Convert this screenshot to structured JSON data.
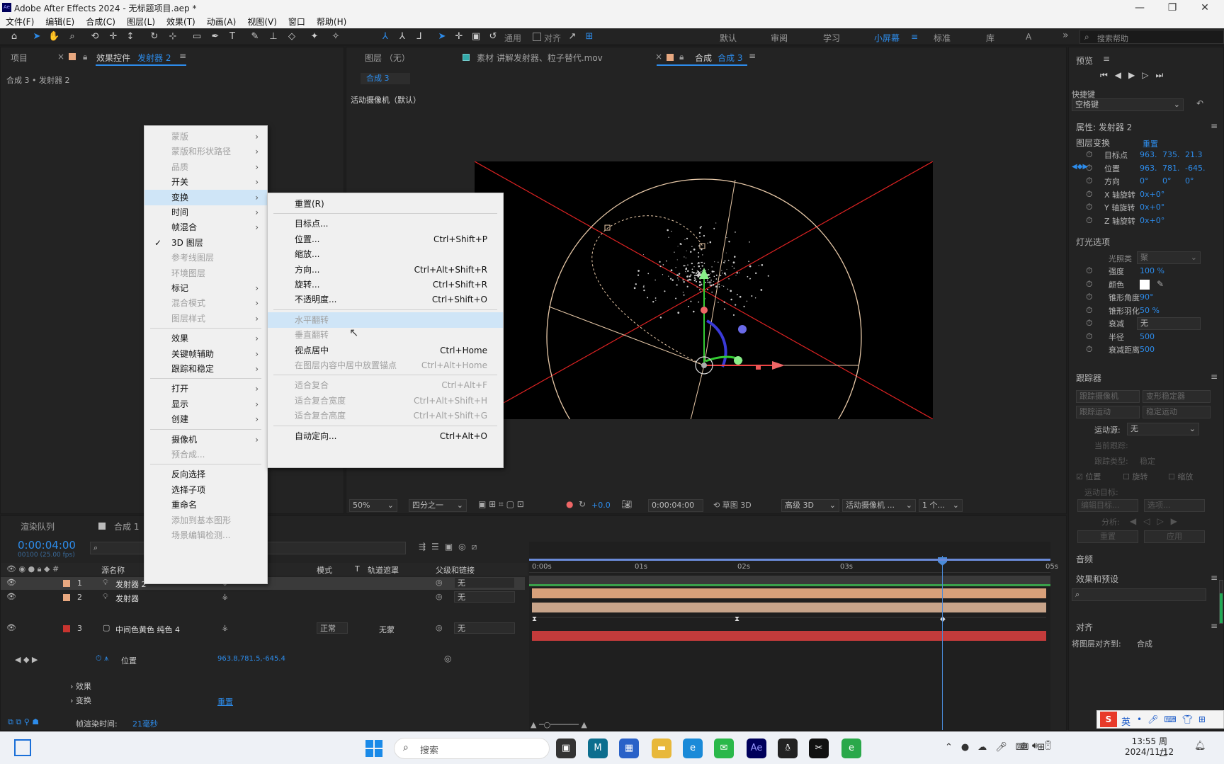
{
  "app": {
    "title": "Adobe After Effects 2024 - 无标题项目.aep *",
    "icon": "Ae"
  },
  "menu": [
    "文件(F)",
    "编辑(E)",
    "合成(C)",
    "图层(L)",
    "效果(T)",
    "动画(A)",
    "视图(V)",
    "窗口",
    "帮助(H)"
  ],
  "toolbar": {
    "general": "通用",
    "align": "对齐",
    "workspaces": [
      "默认",
      "审阅",
      "学习",
      "小屏幕",
      "标准",
      "库"
    ],
    "active_workspace": "小屏幕",
    "search_placeholder": "搜索帮助",
    "more": "»"
  },
  "left_panel": {
    "tab_project": "项目",
    "tab_effects": "效果控件",
    "effects_layer": "发射器 2",
    "breadcrumb": "合成 3 • 发射器 2"
  },
  "viewer": {
    "tab_layer": "图层 （无）",
    "tab_footage": "素材 讲解发射器、粒子替代.mov",
    "tab_comp": "合成",
    "tab_comp_name": "合成 3",
    "comp_chip": "合成 3",
    "camera_label": "活动摄像机（默认）",
    "zoom": "50%",
    "resolution": "四分之一",
    "exposure": "+0.0",
    "timecode": "0:00:04:00",
    "draft3d": "草图 3D",
    "renderer": "高级 3D",
    "view": "活动摄像机 ...",
    "views": "1 个..."
  },
  "ctx_main": [
    {
      "label": "蒙版",
      "dis": true,
      "sub": true
    },
    {
      "label": "蒙版和形状路径",
      "dis": true,
      "sub": true
    },
    {
      "label": "品质",
      "dis": true,
      "sub": true
    },
    {
      "label": "开关",
      "sub": true
    },
    {
      "label": "变换",
      "sub": true,
      "hl": true
    },
    {
      "label": "时间",
      "sub": true
    },
    {
      "label": "帧混合",
      "sub": true
    },
    {
      "label": "3D 图层",
      "check": "✓"
    },
    {
      "label": "参考线图层",
      "dis": true
    },
    {
      "label": "环境图层",
      "dis": true
    },
    {
      "label": "标记",
      "sub": true
    },
    {
      "label": "混合模式",
      "dis": true,
      "sub": true
    },
    {
      "label": "图层样式",
      "dis": true,
      "sub": true
    },
    {
      "sep": true
    },
    {
      "label": "效果",
      "sub": true
    },
    {
      "label": "关键帧辅助",
      "sub": true
    },
    {
      "label": "跟踪和稳定",
      "sub": true
    },
    {
      "sep": true
    },
    {
      "label": "打开",
      "sub": true
    },
    {
      "label": "显示",
      "sub": true
    },
    {
      "label": "创建",
      "sub": true
    },
    {
      "sep": true
    },
    {
      "label": "摄像机",
      "sub": true
    },
    {
      "label": "预合成...",
      "dis": true
    },
    {
      "sep": true
    },
    {
      "label": "反向选择"
    },
    {
      "label": "选择子项"
    },
    {
      "label": "重命名"
    },
    {
      "label": "添加到基本图形",
      "dis": true
    },
    {
      "label": "场景编辑检测...",
      "dis": true
    }
  ],
  "ctx_sub": [
    {
      "label": "重置(R)"
    },
    {
      "sep": true
    },
    {
      "label": "目标点..."
    },
    {
      "label": "位置...",
      "sc": "Ctrl+Shift+P"
    },
    {
      "label": "缩放..."
    },
    {
      "label": "方向...",
      "sc": "Ctrl+Alt+Shift+R"
    },
    {
      "label": "旋转...",
      "sc": "Ctrl+Shift+R"
    },
    {
      "label": "不透明度...",
      "sc": "Ctrl+Shift+O"
    },
    {
      "sep": true
    },
    {
      "label": "水平翻转",
      "dis": true,
      "hl": true
    },
    {
      "label": "垂直翻转",
      "dis": true
    },
    {
      "label": "视点居中",
      "sc": "Ctrl+Home"
    },
    {
      "label": "在图层内容中居中放置锚点",
      "sc": "Ctrl+Alt+Home",
      "dis": true
    },
    {
      "sep": true
    },
    {
      "label": "适合复合",
      "sc": "Ctrl+Alt+F",
      "dis": true
    },
    {
      "label": "适合复合宽度",
      "sc": "Ctrl+Alt+Shift+H",
      "dis": true
    },
    {
      "label": "适合复合高度",
      "sc": "Ctrl+Alt+Shift+G",
      "dis": true
    },
    {
      "sep": true
    },
    {
      "label": "自动定向...",
      "sc": "Ctrl+Alt+O"
    }
  ],
  "right_panel": {
    "preview": "预览",
    "shortcut_label": "快捷键",
    "shortcut_value": "空格键",
    "props_title": "属性: 发射器 2",
    "transform": "图层变换",
    "reset": "重置",
    "rows": [
      {
        "label": "目标点",
        "v": [
          "963.",
          "735.",
          "21.3"
        ]
      },
      {
        "label": "位置",
        "v": [
          "963.",
          "781.",
          "-645."
        ]
      },
      {
        "label": "方向",
        "v": [
          "0°",
          "0°",
          "0°"
        ]
      },
      {
        "label": "X 轴旋转",
        "v": [
          "0x+0°"
        ]
      },
      {
        "label": "Y 轴旋转",
        "v": [
          "0x+0°"
        ]
      },
      {
        "label": "Z 轴旋转",
        "v": [
          "0x+0°"
        ]
      }
    ],
    "light": "灯光选项",
    "light_type_label": "光照类",
    "light_type": "聚",
    "lrows": [
      {
        "label": "强度",
        "v": "100 %"
      },
      {
        "label": "颜色",
        "v": ""
      },
      {
        "label": "锥形角度",
        "v": "90°"
      },
      {
        "label": "锥形羽化",
        "v": "50 %"
      },
      {
        "label": "衰减",
        "v": "无"
      },
      {
        "label": "半径",
        "v": "500"
      },
      {
        "label": "衰减距离",
        "v": "500"
      }
    ],
    "tracker": "跟踪器",
    "track_btns": [
      "跟踪摄像机",
      "变形稳定器",
      "跟踪运动",
      "稳定运动"
    ],
    "motion_src_label": "运动源:",
    "motion_src": "无",
    "cur_track": "当前跟踪:",
    "track_type": "跟踪类型:",
    "track_type_v": "稳定",
    "chk": [
      "位置",
      "旋转",
      "缩放"
    ],
    "motion_target": "运动目标:",
    "edit_target": "编辑目标...",
    "options": "选项...",
    "analyze": "分析:",
    "reset_btn": "重置",
    "apply_btn": "应用",
    "audio": "音频",
    "effects_presets": "效果和预设",
    "align": "对齐",
    "align_to_label": "将图层对齐到:",
    "align_to": "合成"
  },
  "timeline": {
    "tab_render": "渲染队列",
    "tab_comp": "合成 1",
    "timecode": "0:00:04:00",
    "timecode_sub": "00100 (25.00 fps)",
    "cols": {
      "name": "源名称",
      "mode": "模式",
      "t": "T",
      "trkmat": "轨道遮罩",
      "parent": "父级和链接"
    },
    "ruler": [
      "0:00s",
      "01s",
      "02s",
      "03s",
      "",
      "05s"
    ],
    "layers": [
      {
        "num": "1",
        "name": "发射器 2",
        "parent": "无",
        "color": "#e8a880"
      },
      {
        "num": "2",
        "name": "发射器",
        "parent": "无",
        "color": "#e8a880"
      },
      {
        "num": "3",
        "name": "中间色黄色 纯色 4",
        "parent": "无",
        "mode": "正常",
        "trk": "无蒙",
        "color": "#c8342f"
      }
    ],
    "pos_label": "位置",
    "pos_value": "963.8,781.5,-645.4",
    "effects": "效果",
    "transform": "变换",
    "reset": "重置",
    "render_time_label": "帧渲染时间:",
    "render_time": "21毫秒"
  },
  "taskbar": {
    "search": "搜索",
    "time": "13:55 周二",
    "date": "2024/11/12",
    "ime": "英"
  }
}
